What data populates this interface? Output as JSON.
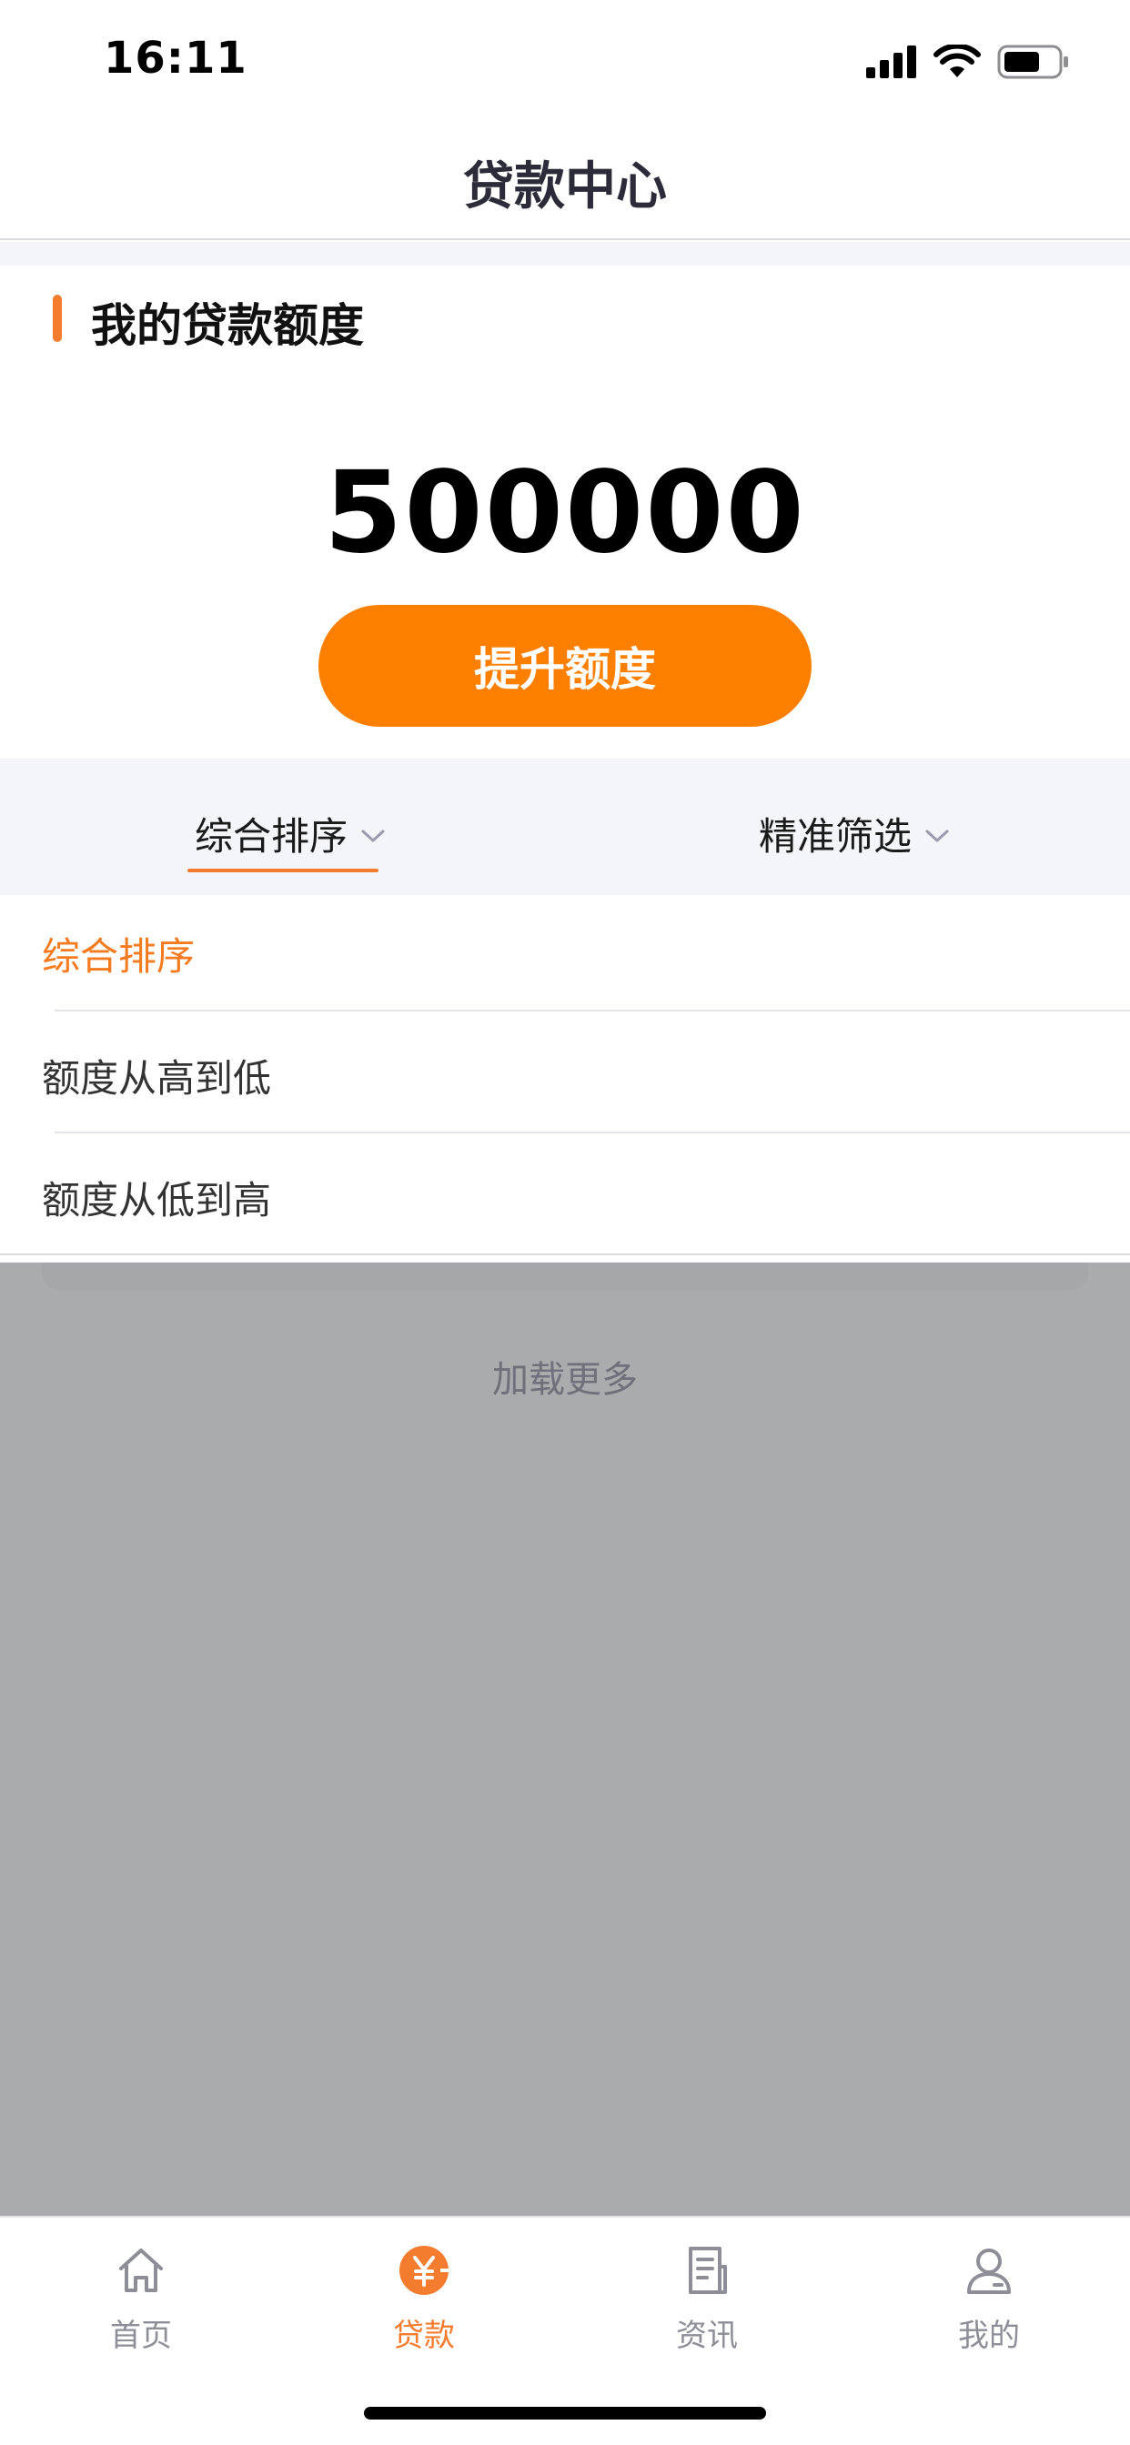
{
  "status_bar": {
    "time": "16:11"
  },
  "nav": {
    "title": "贷款中心"
  },
  "quota": {
    "section_title": "我的贷款额度",
    "amount": "500000",
    "raise_button": "提升额度"
  },
  "filters": {
    "sort_label": "综合排序",
    "filter_label": "精准筛选"
  },
  "sort_options": [
    {
      "label": "综合排序",
      "selected": true
    },
    {
      "label": "额度从高到低",
      "selected": false
    },
    {
      "label": "额度从低到高",
      "selected": false
    }
  ],
  "load_more": "加载更多",
  "tabs": [
    {
      "label": "首页",
      "icon": "home-icon",
      "active": false
    },
    {
      "label": "贷款",
      "icon": "loan-yen-icon",
      "active": true
    },
    {
      "label": "资讯",
      "icon": "news-icon",
      "active": false
    },
    {
      "label": "我的",
      "icon": "profile-icon",
      "active": false
    }
  ],
  "colors": {
    "accent": "#F37C2F",
    "button": "#FD7F00",
    "mask": "#AAABAD"
  }
}
